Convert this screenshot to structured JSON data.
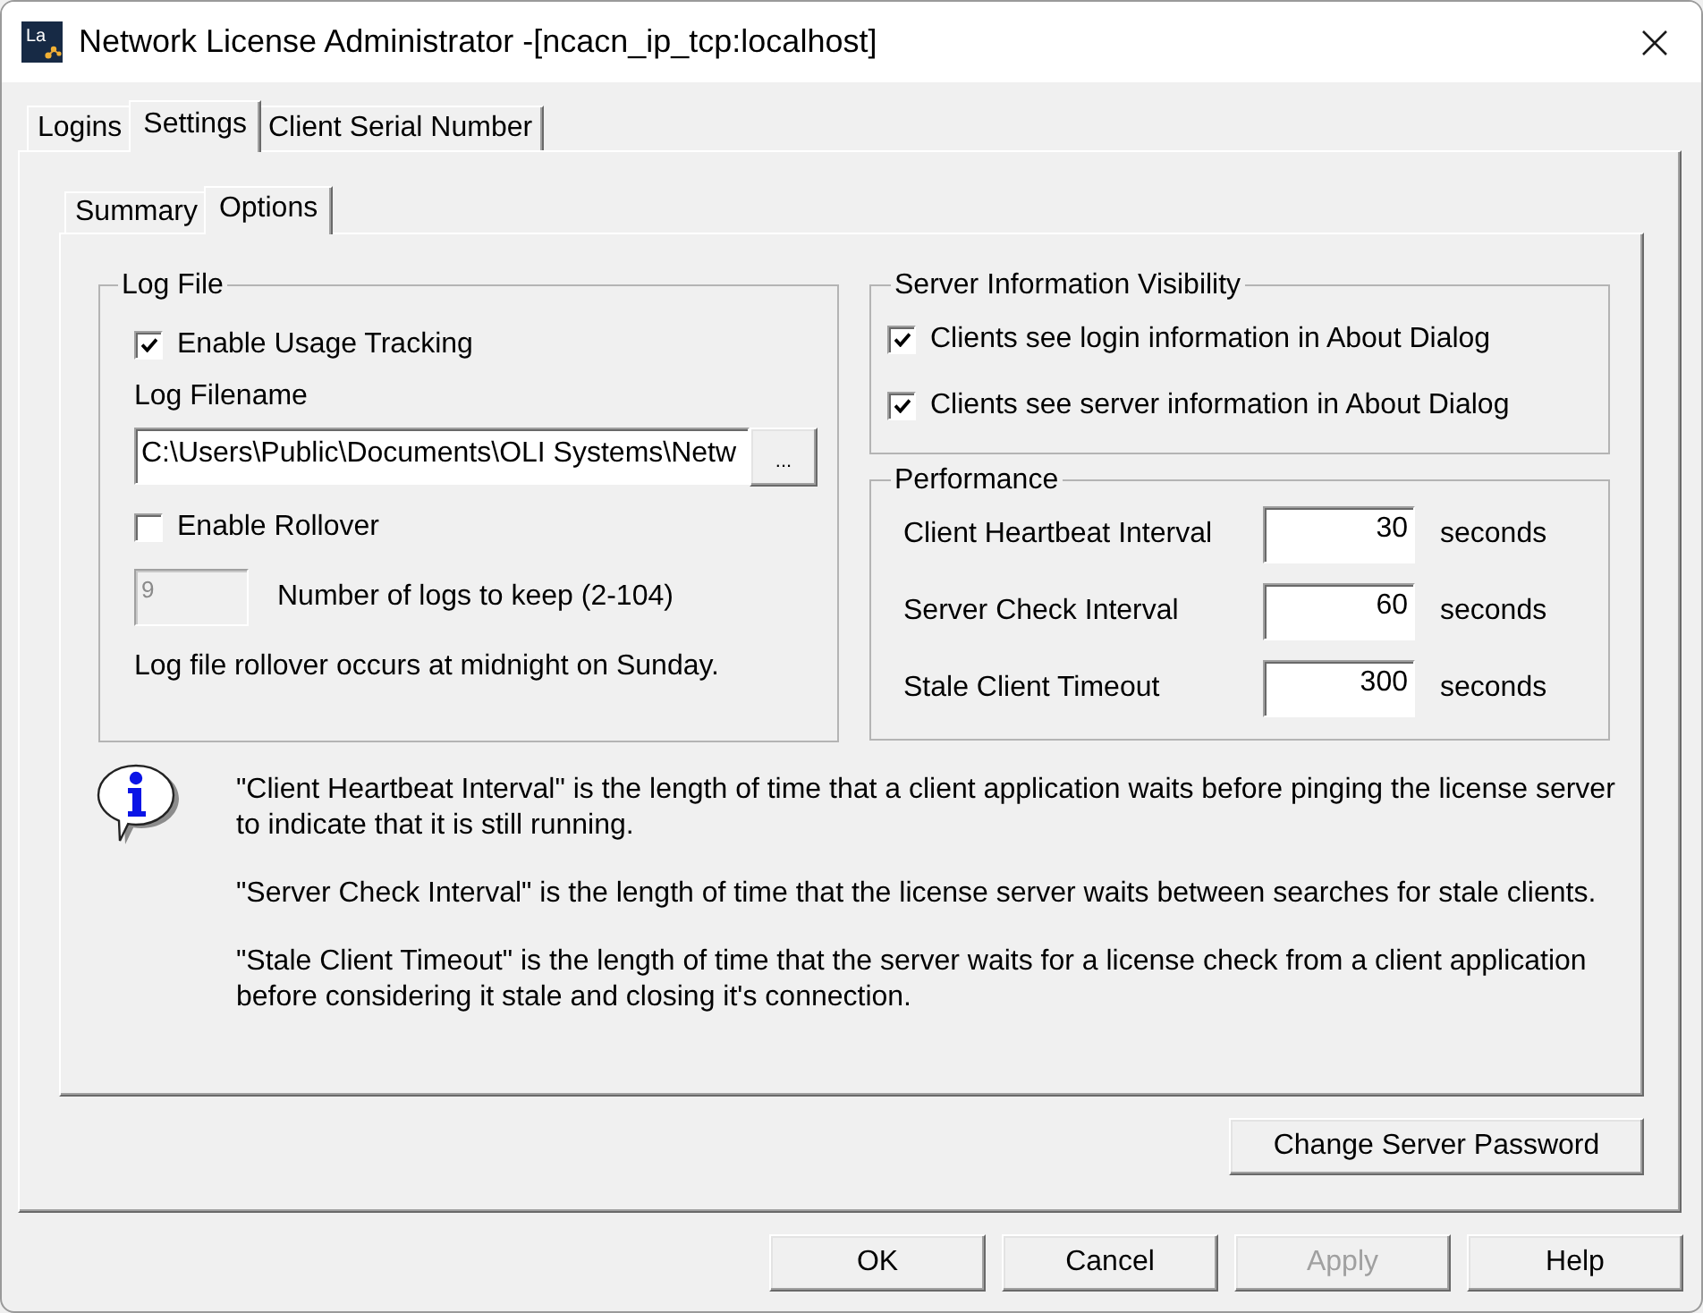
{
  "window": {
    "title": "Network License Administrator -[ncacn_ip_tcp:localhost]",
    "logo_text": "La"
  },
  "tabs": [
    {
      "label": "Logins",
      "selected": false
    },
    {
      "label": "Settings",
      "selected": true
    },
    {
      "label": "Client Serial Number",
      "selected": false
    }
  ],
  "settings_tabs": [
    {
      "label": "Summary",
      "selected": false
    },
    {
      "label": "Options",
      "selected": true
    }
  ],
  "log_file": {
    "title": "Log File",
    "usage_tracking": {
      "label": "Enable Usage Tracking",
      "checked": true
    },
    "filename_label": "Log Filename",
    "filename": "C:\\Users\\Public\\Documents\\OLI Systems\\Netw",
    "browse_button": "...",
    "rollover": {
      "label": "Enable Rollover",
      "checked": false
    },
    "logs_to_keep": {
      "value": "9",
      "label": "Number of logs to keep (2-104)",
      "disabled": true
    },
    "note": "Log file rollover occurs at midnight on Sunday."
  },
  "server_visibility": {
    "title": "Server Information Visibility",
    "options": [
      {
        "label": "Clients see login information in About Dialog",
        "checked": true
      },
      {
        "label": "Clients see server information in About Dialog",
        "checked": true
      }
    ]
  },
  "performance": {
    "title": "Performance",
    "rows": [
      {
        "label": "Client Heartbeat Interval",
        "value": "30",
        "unit": "seconds"
      },
      {
        "label": "Server Check Interval",
        "value": "60",
        "unit": "seconds"
      },
      {
        "label": "Stale Client Timeout",
        "value": "300",
        "unit": "seconds"
      }
    ]
  },
  "info": {
    "paragraphs": [
      "\"Client Heartbeat Interval\" is the length of time that a client application waits before pinging the license server to indicate that it is still running.",
      "\"Server Check Interval\" is the length of time that the license server waits between searches for stale clients.",
      "\"Stale Client Timeout\" is the length of time that the server waits for a license check from a client application before considering it stale and closing it's connection."
    ]
  },
  "change_password_button": "Change Server Password",
  "buttons": [
    {
      "label": "OK",
      "disabled": false
    },
    {
      "label": "Cancel",
      "disabled": false
    },
    {
      "label": "Apply",
      "disabled": true
    },
    {
      "label": "Help",
      "disabled": false
    }
  ]
}
